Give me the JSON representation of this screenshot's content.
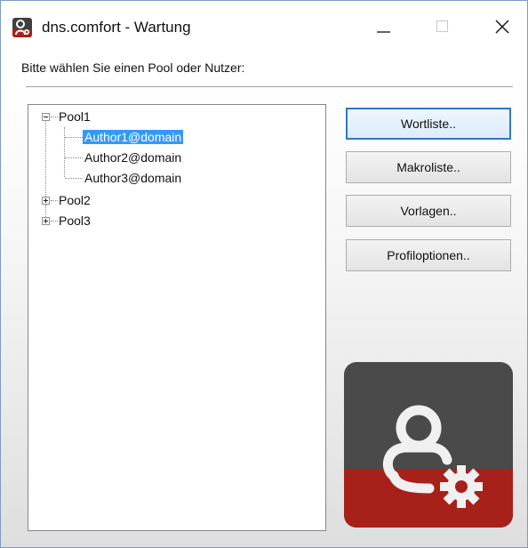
{
  "window": {
    "title": "dns.comfort - Wartung"
  },
  "prompt": "Bitte wählen Sie einen Pool oder Nutzer:",
  "tree": {
    "pools": [
      {
        "label": "Pool1",
        "expanded": true,
        "users": [
          "Author1@domain",
          "Author2@domain",
          "Author3@domain"
        ],
        "selected_user": "Author1@domain"
      },
      {
        "label": "Pool2",
        "expanded": false
      },
      {
        "label": "Pool3",
        "expanded": false
      }
    ]
  },
  "buttons": {
    "wortliste": "Wortliste..",
    "makroliste": "Makroliste..",
    "vorlagen": "Vorlagen..",
    "profiloptionen": "Profiloptionen.."
  },
  "colors": {
    "selection": "#3399ff",
    "logo_dark": "#3f3f3f",
    "logo_red": "#a8201a",
    "focus_border": "#2f77c4"
  },
  "icons": {
    "app": "user-settings-icon",
    "minimize": "minimize-icon",
    "maximize": "maximize-icon",
    "close": "close-icon",
    "logo": "user-gear-logo"
  }
}
